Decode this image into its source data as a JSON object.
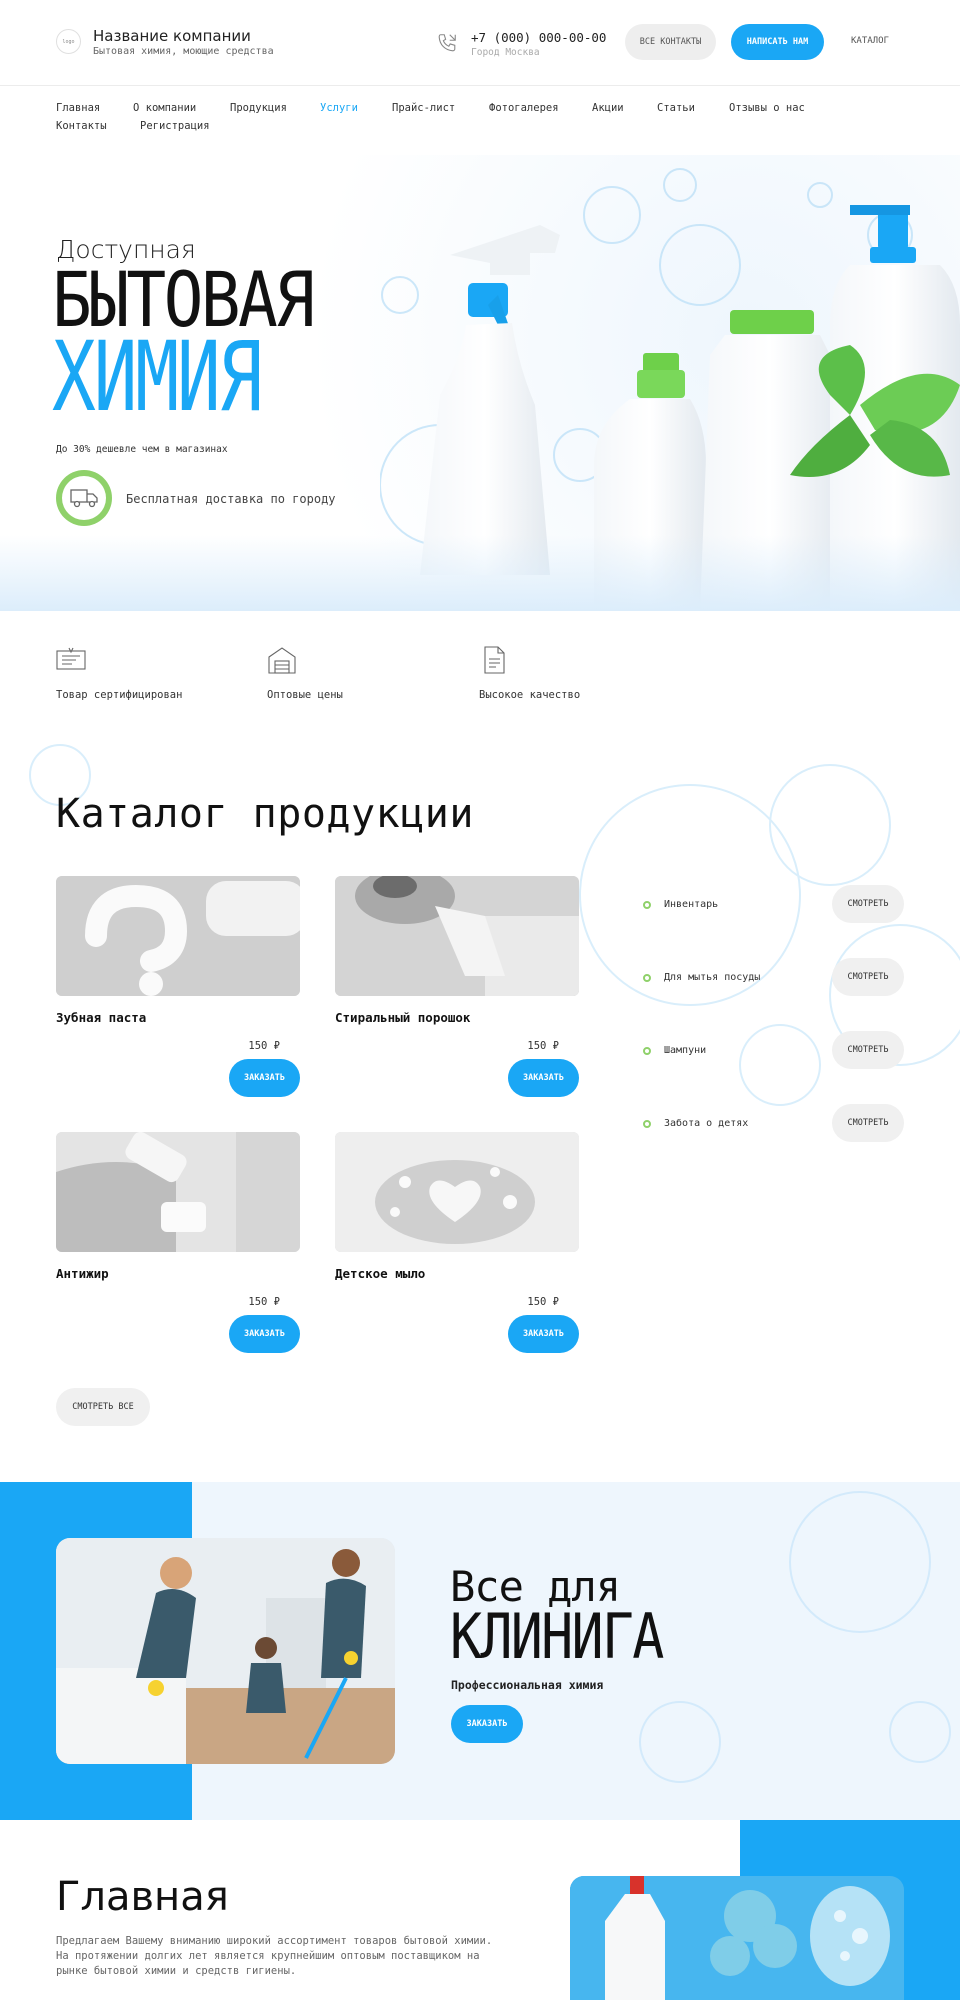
{
  "header": {
    "logo_text": "logo",
    "company_name": "Название компании",
    "company_tagline": "Бытовая химия, моющие средства",
    "phone": "+7 (000) 000-00-00",
    "city": "Город Москва",
    "contacts_button": "ВСЕ КОНТАКТЫ",
    "write_button": "НАПИСАТЬ НАМ",
    "catalog_link": "КАТАЛОГ"
  },
  "nav": {
    "items": [
      "Главная",
      "О компании",
      "Продукция",
      "Услуги",
      "Прайс-лист",
      "Фотогалерея",
      "Акции",
      "Статьи",
      "Отзывы о нас",
      "Контакты",
      "Регистрация"
    ],
    "active": "Услуги"
  },
  "hero": {
    "pre_title": "Доступная",
    "title_line1": "БЫТОВАЯ",
    "title_line2": "ХИМИЯ",
    "note": "До 30% дешевле чем в магазинах",
    "delivery": "Бесплатная доставка по городу"
  },
  "features": [
    {
      "label": "Товар сертифицирован",
      "icon": "certificate-icon"
    },
    {
      "label": "Оптовые цены",
      "icon": "warehouse-icon"
    },
    {
      "label": "Высокое качество",
      "icon": "document-icon"
    }
  ],
  "catalog": {
    "title": "Каталог продукции",
    "products": [
      {
        "name": "Зубная паста",
        "price": "150 ₽",
        "button": "ЗАКАЗАТЬ"
      },
      {
        "name": "Стиральный порошок",
        "price": "150 ₽",
        "button": "ЗАКАЗАТЬ"
      },
      {
        "name": "Антижир",
        "price": "150 ₽",
        "button": "ЗАКАЗАТЬ"
      },
      {
        "name": "Детское мыло",
        "price": "150 ₽",
        "button": "ЗАКАЗАТЬ"
      }
    ],
    "categories": [
      {
        "label": "Инвентарь",
        "button": "СМОТРЕТЬ"
      },
      {
        "label": "Для мытья посуды",
        "button": "СМОТРЕТЬ"
      },
      {
        "label": "Шампуни",
        "button": "СМОТРЕТЬ"
      },
      {
        "label": "Забота о детях",
        "button": "СМОТРЕТЬ"
      }
    ],
    "see_all": "СМОТРЕТЬ ВСЕ"
  },
  "cleaning": {
    "pre_title": "Все для",
    "title": "КЛИНИГА",
    "subtitle": "Профессиональная химия",
    "button": "ЗАКАЗАТЬ"
  },
  "about": {
    "title": "Главная",
    "text": "Предлагаем Вашему вниманию широкий ассортимент товаров бытовой химии. На протяжении долгих лет является крупнейшим оптовым поставщиком на рынке бытовой химии и средств гигиены."
  },
  "colors": {
    "accent": "#1aa7f5",
    "green": "#8fd16a",
    "button_gray": "#eeeeee",
    "text_dark": "#111111"
  }
}
